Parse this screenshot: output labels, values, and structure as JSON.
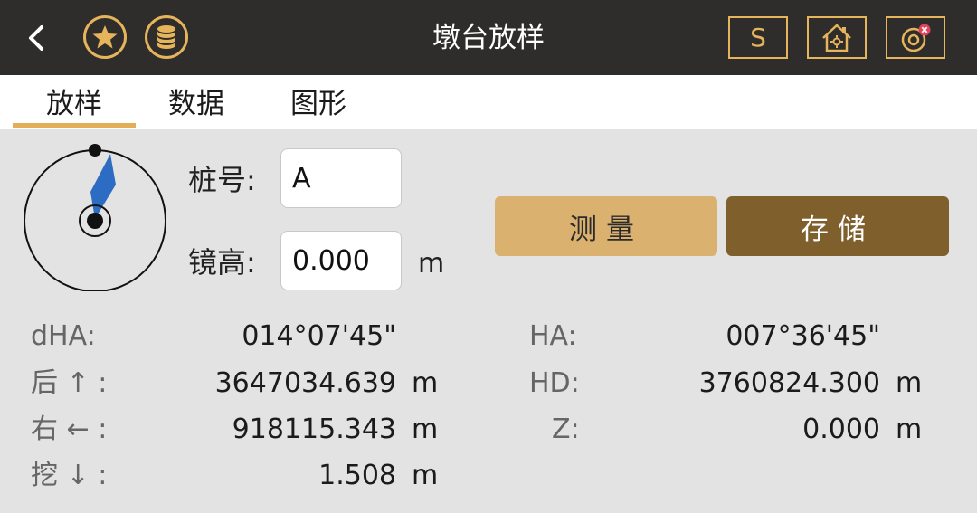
{
  "header": {
    "title": "墩台放样",
    "back_icon": "chevron-left-icon",
    "star_icon": "star-icon",
    "database_icon": "database-icon",
    "s_label": "S",
    "home_icon": "home-settings-icon",
    "target_icon": "target-close-icon",
    "accent_color": "#e6b45a"
  },
  "tabs": [
    {
      "label": "放样",
      "active": true
    },
    {
      "label": "数据",
      "active": false
    },
    {
      "label": "图形",
      "active": false
    }
  ],
  "form": {
    "stake_label": "桩号:",
    "stake_value": "A",
    "mirror_label": "镜高:",
    "mirror_value": "0.000",
    "mirror_unit": "m"
  },
  "actions": {
    "measure_label": "测量",
    "store_label": "存储"
  },
  "readings_left": [
    {
      "label": "dHA:",
      "value": "014°07'45\"",
      "unit": ""
    },
    {
      "label": "后 ↑ :",
      "value": "3647034.639",
      "unit": "m"
    },
    {
      "label": "右 ← :",
      "value": "918115.343",
      "unit": "m"
    },
    {
      "label": "挖 ↓ :",
      "value": "1.508",
      "unit": "m"
    }
  ],
  "readings_right": [
    {
      "label": "HA:",
      "value": "007°36'45\"",
      "unit": ""
    },
    {
      "label": "HD:",
      "value": "3760824.300",
      "unit": "m"
    },
    {
      "label": "Z:",
      "value": "0.000",
      "unit": "m"
    }
  ]
}
